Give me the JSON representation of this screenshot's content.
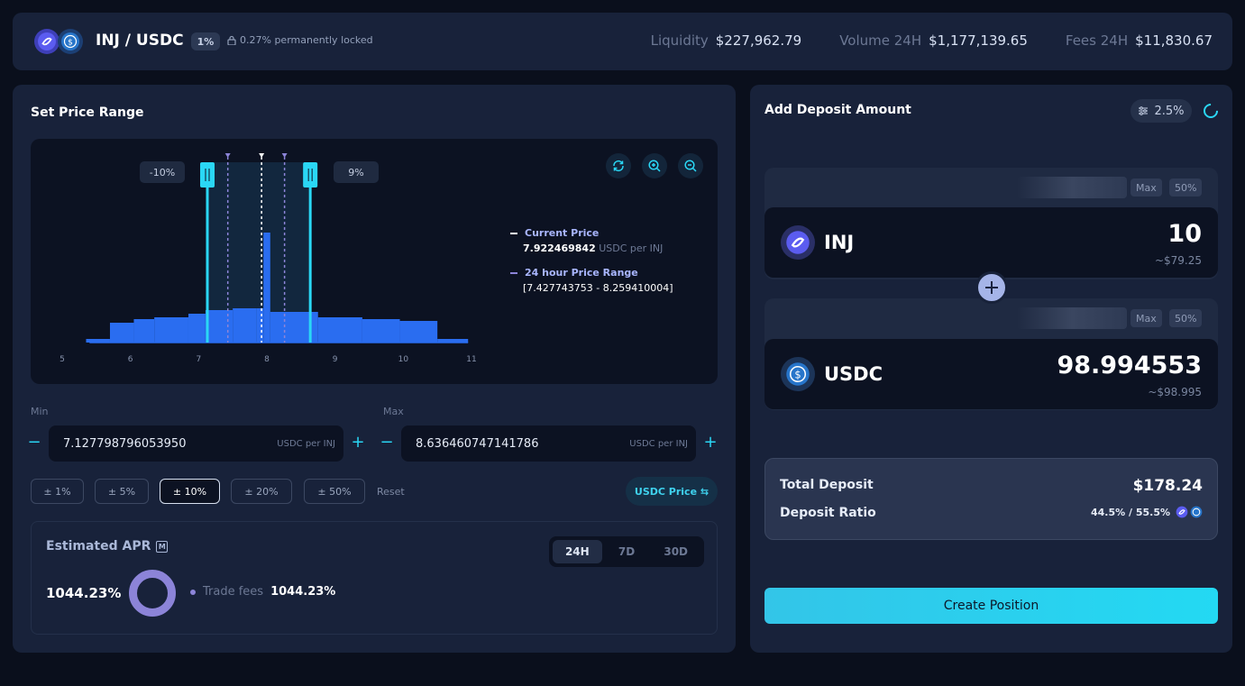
{
  "header": {
    "pair": "INJ / USDC",
    "fee_tier": "1%",
    "lock_text": "0.27% permanently locked",
    "stats": [
      {
        "label": "Liquidity",
        "value": "$227,962.79"
      },
      {
        "label": "Volume 24H",
        "value": "$1,177,139.65"
      },
      {
        "label": "Fees 24H",
        "value": "$11,830.67"
      }
    ]
  },
  "range_panel": {
    "title": "Set Price Range",
    "chart": {
      "min_pct_label": "-10%",
      "max_pct_label": "9%",
      "legend": {
        "current_label": "Current Price",
        "current_value": "7.922469842",
        "current_unit": "USDC per INJ",
        "range_label": "24 hour Price Range",
        "range_value": "[7.427743753 - 8.259410004]"
      }
    },
    "min_label": "Min",
    "max_label": "Max",
    "min_value": "7.127798796053950",
    "max_value": "8.636460747141786",
    "unit": "USDC per INJ",
    "presets": [
      "± 1%",
      "± 5%",
      "± 10%",
      "± 20%",
      "± 50%"
    ],
    "reset": "Reset",
    "usdc_price_button": "USDC Price ⇆",
    "apr": {
      "title": "Estimated APR",
      "badge": "M",
      "tabs": [
        "24H",
        "7D",
        "30D"
      ],
      "value": "1044.23%",
      "trade_fees_label": "Trade fees",
      "trade_fees_value": "1044.23%"
    }
  },
  "chart_data": {
    "type": "bar",
    "x_ticks": [
      "5",
      "6",
      "7",
      "8",
      "9",
      "10",
      "11"
    ],
    "xlim": [
      5,
      11
    ],
    "bins": [
      {
        "x0": 5.35,
        "x1": 5.7,
        "v": 0.02
      },
      {
        "x0": 5.7,
        "x1": 6.05,
        "v": 0.11
      },
      {
        "x0": 6.05,
        "x1": 6.35,
        "v": 0.13
      },
      {
        "x0": 6.35,
        "x1": 6.85,
        "v": 0.14
      },
      {
        "x0": 6.85,
        "x1": 7.1,
        "v": 0.16
      },
      {
        "x0": 7.1,
        "x1": 7.5,
        "v": 0.18
      },
      {
        "x0": 7.5,
        "x1": 7.85,
        "v": 0.19
      },
      {
        "x0": 7.85,
        "x1": 7.95,
        "v": 0.19
      },
      {
        "x0": 7.95,
        "x1": 8.05,
        "v": 0.61
      },
      {
        "x0": 8.05,
        "x1": 8.75,
        "v": 0.17
      },
      {
        "x0": 8.75,
        "x1": 9.4,
        "v": 0.14
      },
      {
        "x0": 9.4,
        "x1": 9.95,
        "v": 0.13
      },
      {
        "x0": 9.95,
        "x1": 10.5,
        "v": 0.12
      },
      {
        "x0": 10.5,
        "x1": 10.95,
        "v": 0.02
      }
    ],
    "current_price": 7.922469842,
    "range_24h": [
      7.427743753,
      8.259410004
    ],
    "selected_min": 7.12779879605395,
    "selected_max": 8.636460747141786
  },
  "deposit_panel": {
    "title": "Add Deposit Amount",
    "slippage": "2.5%",
    "tokens": [
      {
        "symbol": "INJ",
        "amount": "10",
        "usd": "~$79.25",
        "max": "Max",
        "half": "50%"
      },
      {
        "symbol": "USDC",
        "amount": "98.994553",
        "usd": "~$98.995",
        "max": "Max",
        "half": "50%"
      }
    ],
    "total_label": "Total Deposit",
    "total_value": "$178.24",
    "ratio_label": "Deposit Ratio",
    "ratio_value": "44.5% / 55.5%",
    "create_button": "Create Position"
  },
  "colors": {
    "accent": "#2ad7f5",
    "inj": "#5b5cf0",
    "usdc": "#2775ca",
    "bar": "#2a6df0"
  }
}
